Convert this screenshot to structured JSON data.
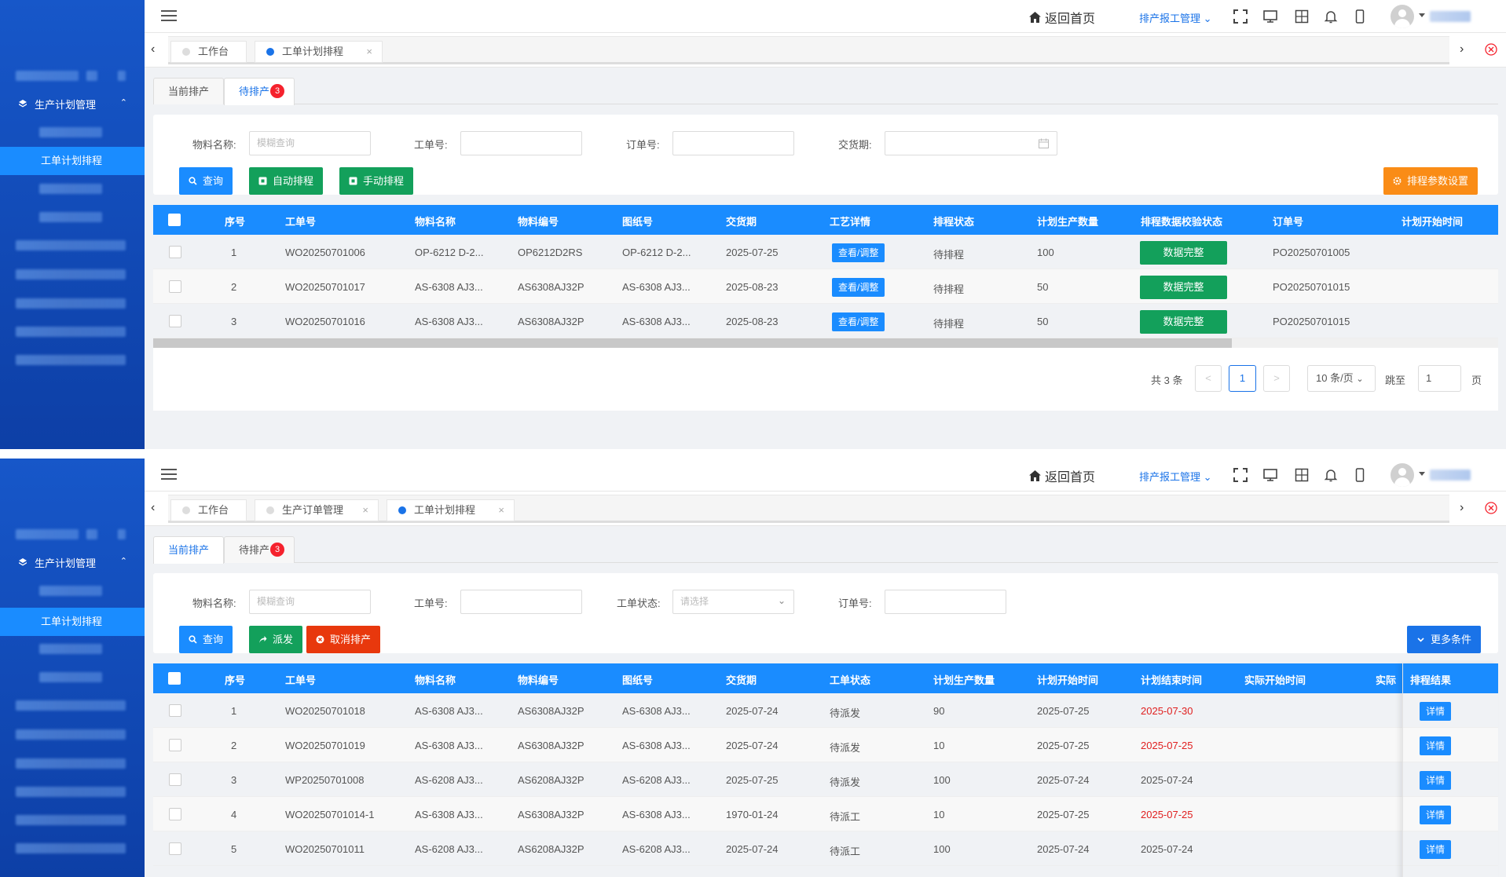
{
  "top": {
    "menu": {
      "group_label": "生产计划管理",
      "active_item": "工单计划排程"
    },
    "header": {
      "home_label": "返回首页",
      "schedule_menu": "排产报工管理"
    },
    "page_tabs": [
      {
        "label": "工作台",
        "active": false,
        "closable": false
      },
      {
        "label": "工单计划排程",
        "active": true,
        "closable": true
      }
    ],
    "sub_tabs": {
      "current": "当前排产",
      "pending": "待排产",
      "pending_count": "3"
    },
    "filters": {
      "material_name": {
        "label": "物料名称:",
        "placeholder": "模糊查询"
      },
      "work_order": {
        "label": "工单号:"
      },
      "order_no": {
        "label": "订单号:"
      },
      "delivery": {
        "label": "交货期:"
      }
    },
    "buttons": {
      "query": "查询",
      "auto": "自动排程",
      "manual": "手动排程",
      "params": "排程参数设置"
    },
    "columns": [
      "序号",
      "工单号",
      "物料名称",
      "物料编号",
      "图纸号",
      "交货期",
      "工艺详情",
      "排程状态",
      "计划生产数量",
      "排程数据校验状态",
      "订单号",
      "计划开始时间"
    ],
    "rows": [
      {
        "no": "1",
        "wo": "WO20250701006",
        "mat": "OP-6212 D-2...",
        "code": "OP6212D2RS",
        "draw": "OP-6212 D-2...",
        "date": "2025-07-25",
        "detail": "查看/调整",
        "status": "待排程",
        "qty": "100",
        "check": "数据完整",
        "order": "PO20250701005"
      },
      {
        "no": "2",
        "wo": "WO20250701017",
        "mat": "AS-6308 AJ3...",
        "code": "AS6308AJ32P",
        "draw": "AS-6308 AJ3...",
        "date": "2025-08-23",
        "detail": "查看/调整",
        "status": "待排程",
        "qty": "50",
        "check": "数据完整",
        "order": "PO20250701015"
      },
      {
        "no": "3",
        "wo": "WO20250701016",
        "mat": "AS-6308 AJ3...",
        "code": "AS6308AJ32P",
        "draw": "AS-6308 AJ3...",
        "date": "2025-08-23",
        "detail": "查看/调整",
        "status": "待排程",
        "qty": "50",
        "check": "数据完整",
        "order": "PO20250701015"
      }
    ],
    "pager": {
      "total": "共 3 条",
      "prev": "<",
      "page": "1",
      "next": ">",
      "size": "10 条/页",
      "goto": "跳至",
      "goto_value": "1",
      "page_suffix": "页"
    }
  },
  "bottom": {
    "menu": {
      "group_label": "生产计划管理",
      "active_item": "工单计划排程"
    },
    "header": {
      "home_label": "返回首页",
      "schedule_menu": "排产报工管理"
    },
    "page_tabs": [
      {
        "label": "工作台",
        "active": false,
        "closable": false
      },
      {
        "label": "生产订单管理",
        "active": false,
        "closable": true
      },
      {
        "label": "工单计划排程",
        "active": true,
        "closable": true
      }
    ],
    "sub_tabs": {
      "current": "当前排产",
      "pending": "待排产",
      "pending_count": "3"
    },
    "filters": {
      "material_name": {
        "label": "物料名称:",
        "placeholder": "模糊查询"
      },
      "work_order": {
        "label": "工单号:"
      },
      "wo_status": {
        "label": "工单状态:",
        "placeholder": "请选择"
      },
      "order_no": {
        "label": "订单号:"
      }
    },
    "buttons": {
      "query": "查询",
      "dispatch": "派发",
      "cancel": "取消排产",
      "more": "更多条件"
    },
    "columns": [
      "序号",
      "工单号",
      "物料名称",
      "物料编号",
      "图纸号",
      "交货期",
      "工单状态",
      "计划生产数量",
      "计划开始时间",
      "计划结束时间",
      "实际开始时间",
      "实际",
      "排程结果"
    ],
    "rows": [
      {
        "no": "1",
        "wo": "WO20250701018",
        "mat": "AS-6308 AJ3...",
        "code": "AS6308AJ32P",
        "draw": "AS-6308 AJ3...",
        "date": "2025-07-24",
        "status": "待派发",
        "qty": "90",
        "start": "2025-07-25",
        "end": "2025-07-30",
        "late": true,
        "result": "详情"
      },
      {
        "no": "2",
        "wo": "WO20250701019",
        "mat": "AS-6308 AJ3...",
        "code": "AS6308AJ32P",
        "draw": "AS-6308 AJ3...",
        "date": "2025-07-24",
        "status": "待派发",
        "qty": "10",
        "start": "2025-07-25",
        "end": "2025-07-25",
        "late": true,
        "result": "详情"
      },
      {
        "no": "3",
        "wo": "WP20250701008",
        "mat": "AS-6208 AJ3...",
        "code": "AS6208AJ32P",
        "draw": "AS-6208 AJ3...",
        "date": "2025-07-25",
        "status": "待派发",
        "qty": "100",
        "start": "2025-07-24",
        "end": "2025-07-24",
        "late": false,
        "result": "详情"
      },
      {
        "no": "4",
        "wo": "WO20250701014-1",
        "mat": "AS-6308 AJ3...",
        "code": "AS6308AJ32P",
        "draw": "AS-6308 AJ3...",
        "date": "1970-01-24",
        "status": "待派工",
        "qty": "10",
        "start": "2025-07-25",
        "end": "2025-07-25",
        "late": true,
        "result": "详情"
      },
      {
        "no": "5",
        "wo": "WO20250701011",
        "mat": "AS-6208 AJ3...",
        "code": "AS6208AJ32P",
        "draw": "AS-6208 AJ3...",
        "date": "2025-07-24",
        "status": "待派工",
        "qty": "100",
        "start": "2025-07-24",
        "end": "2025-07-24",
        "late": false,
        "result": "详情"
      }
    ]
  },
  "colors": {
    "primary": "#1a8cff",
    "sidebar": "#1757c9",
    "green": "#13a05b",
    "orange": "#fa8c16",
    "danger": "#f5222d",
    "late": "#e02020"
  },
  "icons": [
    "menu-icon",
    "home-icon",
    "fullscreen-icon",
    "monitor-icon",
    "layout-icon",
    "bell-icon",
    "mobile-icon",
    "user-avatar-icon",
    "search-icon",
    "calendar-icon",
    "gear-icon",
    "send-icon",
    "cancel-icon",
    "chevron-down-icon",
    "close-circle-icon"
  ]
}
